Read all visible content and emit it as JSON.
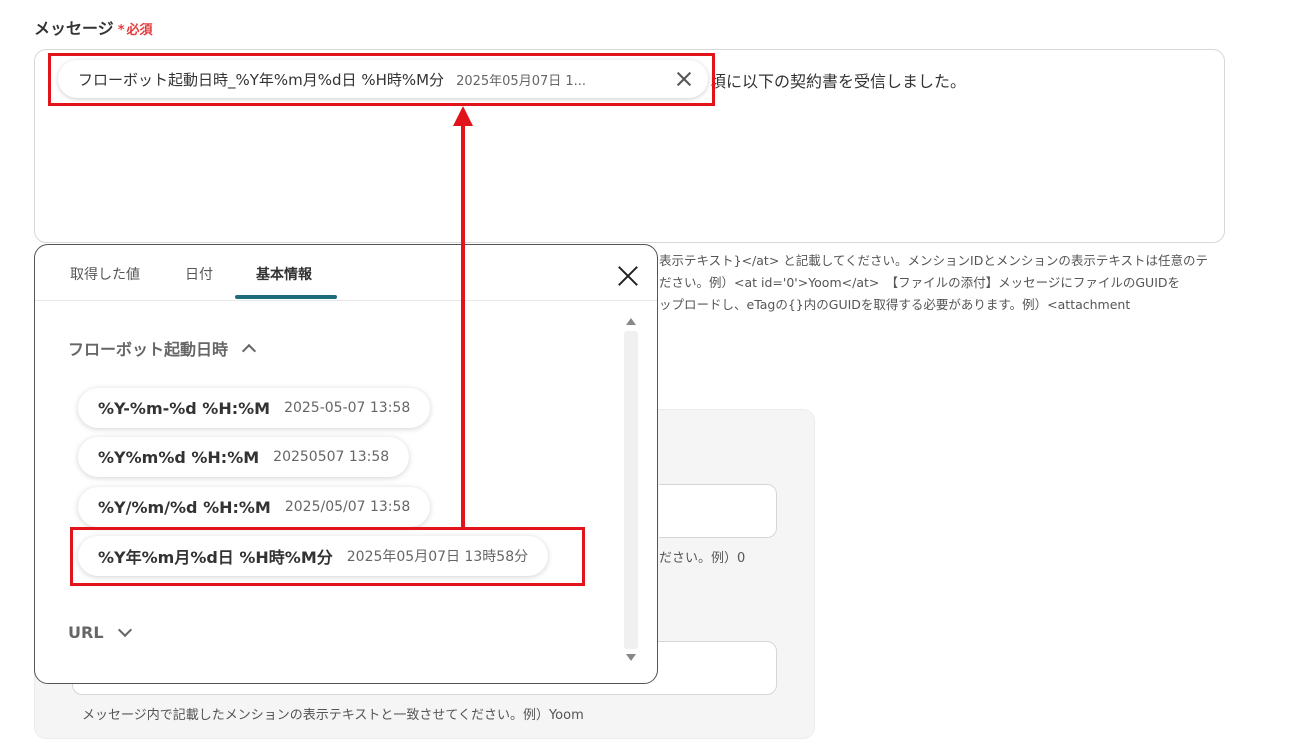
{
  "field": {
    "label": "メッセージ",
    "required_mark": "*",
    "required_text": "必須",
    "message_text": "頃に以下の契約書を受信しました。"
  },
  "chip": {
    "title": "フローボット起動日時_%Y年%m月%d日 %H時%M分",
    "value": "2025年05月07日 1..."
  },
  "help_lines": [
    "表示テキスト}</at> と記載してください。メンションIDとメンションの表示テキストは任意のテ",
    "ださい。例）<at id='0'>Yoom</at>　【ファイルの添付】メッセージにファイルのGUIDを",
    "ップロードし、eTagの{}内のGUIDを取得する必要があります。例）<attachment"
  ],
  "lower": {
    "hint_a": "ださい。例）0",
    "hint_b": "メッセージ内で記載したメンションの表示テキストと一致させてください。例）Yoom"
  },
  "popup": {
    "tabs": [
      {
        "label": "取得した値",
        "active": false
      },
      {
        "label": "日付",
        "active": false
      },
      {
        "label": "基本情報",
        "active": true
      }
    ],
    "section_title": "フローボット起動日時",
    "options": [
      {
        "format": "%Y-%m-%d %H:%M",
        "example": "2025-05-07 13:58"
      },
      {
        "format": "%Y%m%d %H:%M",
        "example": "20250507 13:58"
      },
      {
        "format": "%Y/%m/%d %H:%M",
        "example": "2025/05/07 13:58"
      },
      {
        "format": "%Y年%m月%d日 %H時%M分",
        "example": "2025年05月07日 13時58分"
      }
    ],
    "url_section": "URL"
  },
  "colors": {
    "accent": "#1f6b7d",
    "highlight": "#e0141a",
    "required": "#e53e3e"
  },
  "icons": [
    "close-icon",
    "chevron-up-icon",
    "chevron-down-icon",
    "scroll-up-arrow-icon",
    "scroll-down-arrow-icon"
  ]
}
